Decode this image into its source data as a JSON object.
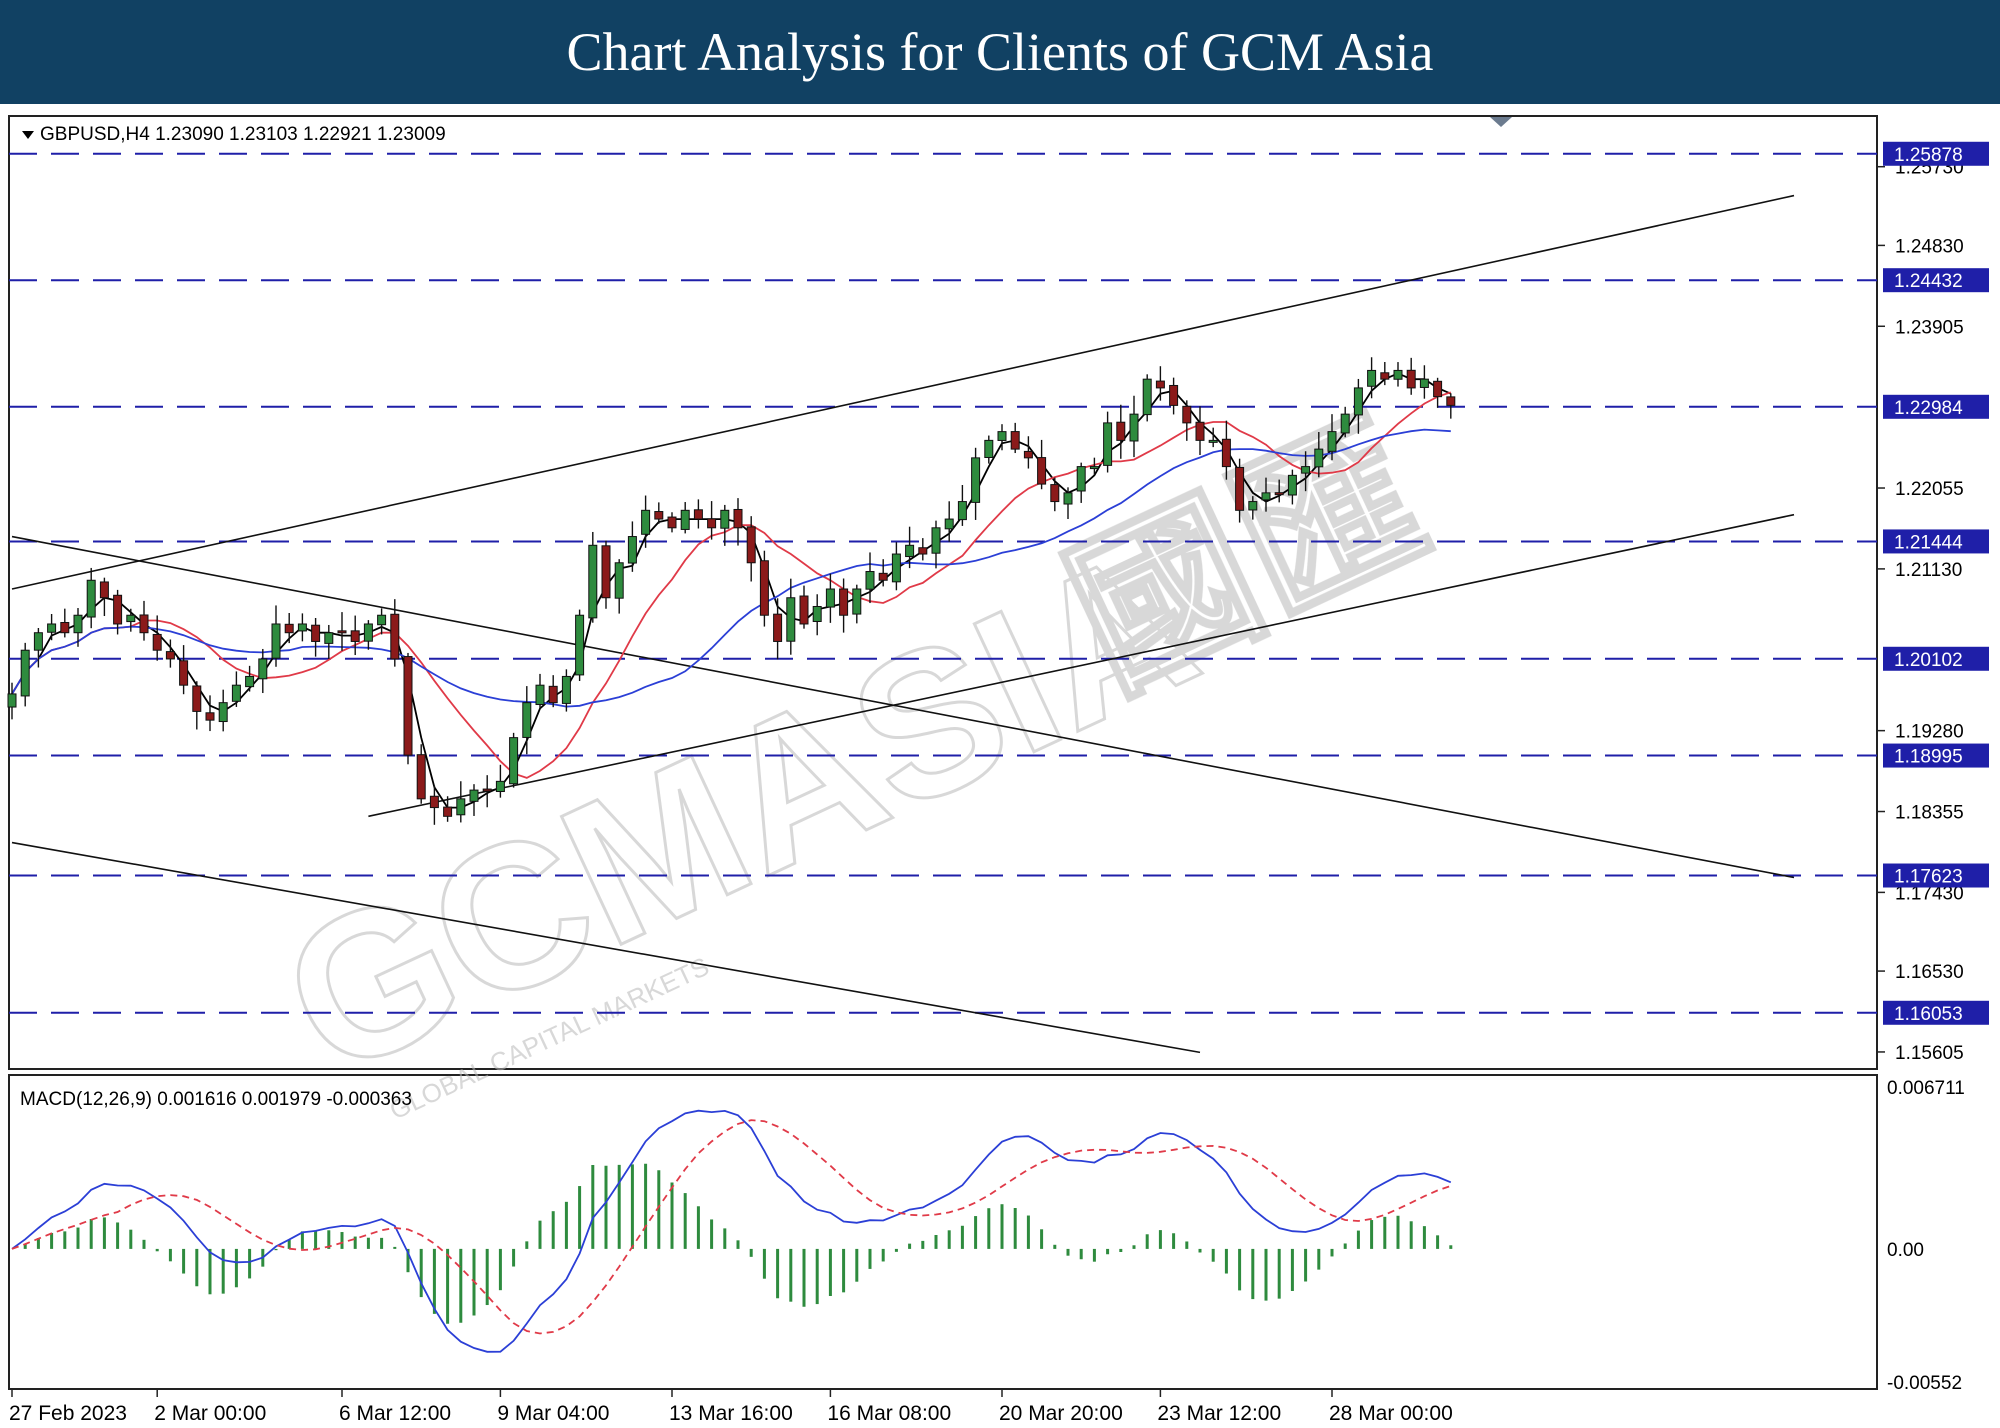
{
  "header": {
    "title": "Chart Analysis for Clients of GCM Asia"
  },
  "watermark": {
    "text": "GCMASIA",
    "cn_text": "國匯",
    "sub": "GLOBAL CAPITAL MARKETS"
  },
  "colors": {
    "bull": "#2e8b3e",
    "bear": "#8b1a1a",
    "ma_fast": "#000000",
    "ma_mid": "#e03a48",
    "ma_slow": "#2b3fd6",
    "level_line": "#1f1fa8",
    "label_box": "#1f1fa8",
    "macd_line": "#2b3fd6",
    "signal_line": "#e03a48",
    "histogram": "#2e8b3e"
  },
  "chart_data": [
    {
      "type": "candlestick",
      "title": "GBPUSD,H4  1.23090 1.23103 1.22921 1.23009",
      "symbol": "GBPUSD",
      "timeframe": "H4",
      "ohlc_last": {
        "open": "1.23090",
        "high": "1.23103",
        "low": "1.22921",
        "close": "1.23009"
      },
      "ylim": [
        1.1541,
        1.2631
      ],
      "y_ticks": [
        "1.25730",
        "1.24830",
        "1.23905",
        "1.22055",
        "1.21130",
        "1.19280",
        "1.18355",
        "1.17430",
        "1.16530",
        "1.15605"
      ],
      "x_ticks": [
        "27 Feb 2023",
        "2 Mar 00:00",
        "6 Mar 12:00",
        "9 Mar 04:00",
        "13 Mar 16:00",
        "16 Mar 08:00",
        "20 Mar 20:00",
        "23 Mar 12:00",
        "28 Mar 00:00"
      ],
      "x_tick_index": [
        0,
        11,
        25,
        37,
        50,
        62,
        75,
        87,
        100
      ],
      "levels": [
        {
          "value": 1.25878,
          "label": "1.25878"
        },
        {
          "value": 1.24432,
          "label": "1.24432"
        },
        {
          "value": 1.22984,
          "label": "1.22984"
        },
        {
          "value": 1.21444,
          "label": "1.21444"
        },
        {
          "value": 1.20102,
          "label": "1.20102"
        },
        {
          "value": 1.18995,
          "label": "1.18995"
        },
        {
          "value": 1.17623,
          "label": "1.17623"
        },
        {
          "value": 1.16053,
          "label": "1.16053"
        }
      ],
      "trendlines": [
        {
          "name": "channel-up-upper",
          "from": [
            0,
            1.209
          ],
          "to": [
            135,
            1.254
          ]
        },
        {
          "name": "channel-up-lower",
          "from": [
            27,
            1.183
          ],
          "to": [
            135,
            1.2175
          ]
        },
        {
          "name": "channel-down-upper",
          "from": [
            0,
            1.215
          ],
          "to": [
            135,
            1.176
          ]
        },
        {
          "name": "channel-down-lower",
          "from": [
            0,
            1.18
          ],
          "to": [
            90,
            1.156
          ]
        }
      ],
      "candles_close": [
        1.197,
        1.202,
        1.204,
        1.205,
        1.204,
        1.206,
        1.21,
        1.208,
        1.205,
        1.206,
        1.204,
        1.202,
        1.201,
        1.198,
        1.195,
        1.194,
        1.196,
        1.198,
        1.199,
        1.201,
        1.205,
        1.204,
        1.205,
        1.203,
        1.204,
        1.204,
        1.203,
        1.205,
        1.206,
        1.201,
        1.19,
        1.185,
        1.184,
        1.183,
        1.185,
        1.186,
        1.186,
        1.187,
        1.192,
        1.196,
        1.198,
        1.196,
        1.199,
        1.206,
        1.214,
        1.208,
        1.212,
        1.215,
        1.218,
        1.217,
        1.216,
        1.218,
        1.217,
        1.216,
        1.218,
        1.216,
        1.212,
        1.206,
        1.203,
        1.208,
        1.205,
        1.207,
        1.209,
        1.206,
        1.209,
        1.211,
        1.21,
        1.213,
        1.214,
        1.213,
        1.216,
        1.217,
        1.219,
        1.224,
        1.226,
        1.227,
        1.225,
        1.224,
        1.221,
        1.219,
        1.22,
        1.223,
        1.223,
        1.228,
        1.226,
        1.229,
        1.233,
        1.232,
        1.23,
        1.228,
        1.226,
        1.226,
        1.223,
        1.218,
        1.219,
        1.22,
        1.22,
        1.222,
        1.223,
        1.225,
        1.227,
        1.229,
        1.232,
        1.234,
        1.233,
        1.234,
        1.232,
        1.233,
        1.231,
        1.23
      ],
      "indicator": {
        "name": "MACD(12,26,9)",
        "values_text": "0.001616 0.001979 -0.000363",
        "macd": 0.001616,
        "signal": 0.001979,
        "histogram": -0.000363,
        "ylim": [
          -0.0058,
          0.0072
        ],
        "y_ticks": [
          "0.006711",
          "0.00",
          "-0.00552"
        ]
      }
    }
  ]
}
